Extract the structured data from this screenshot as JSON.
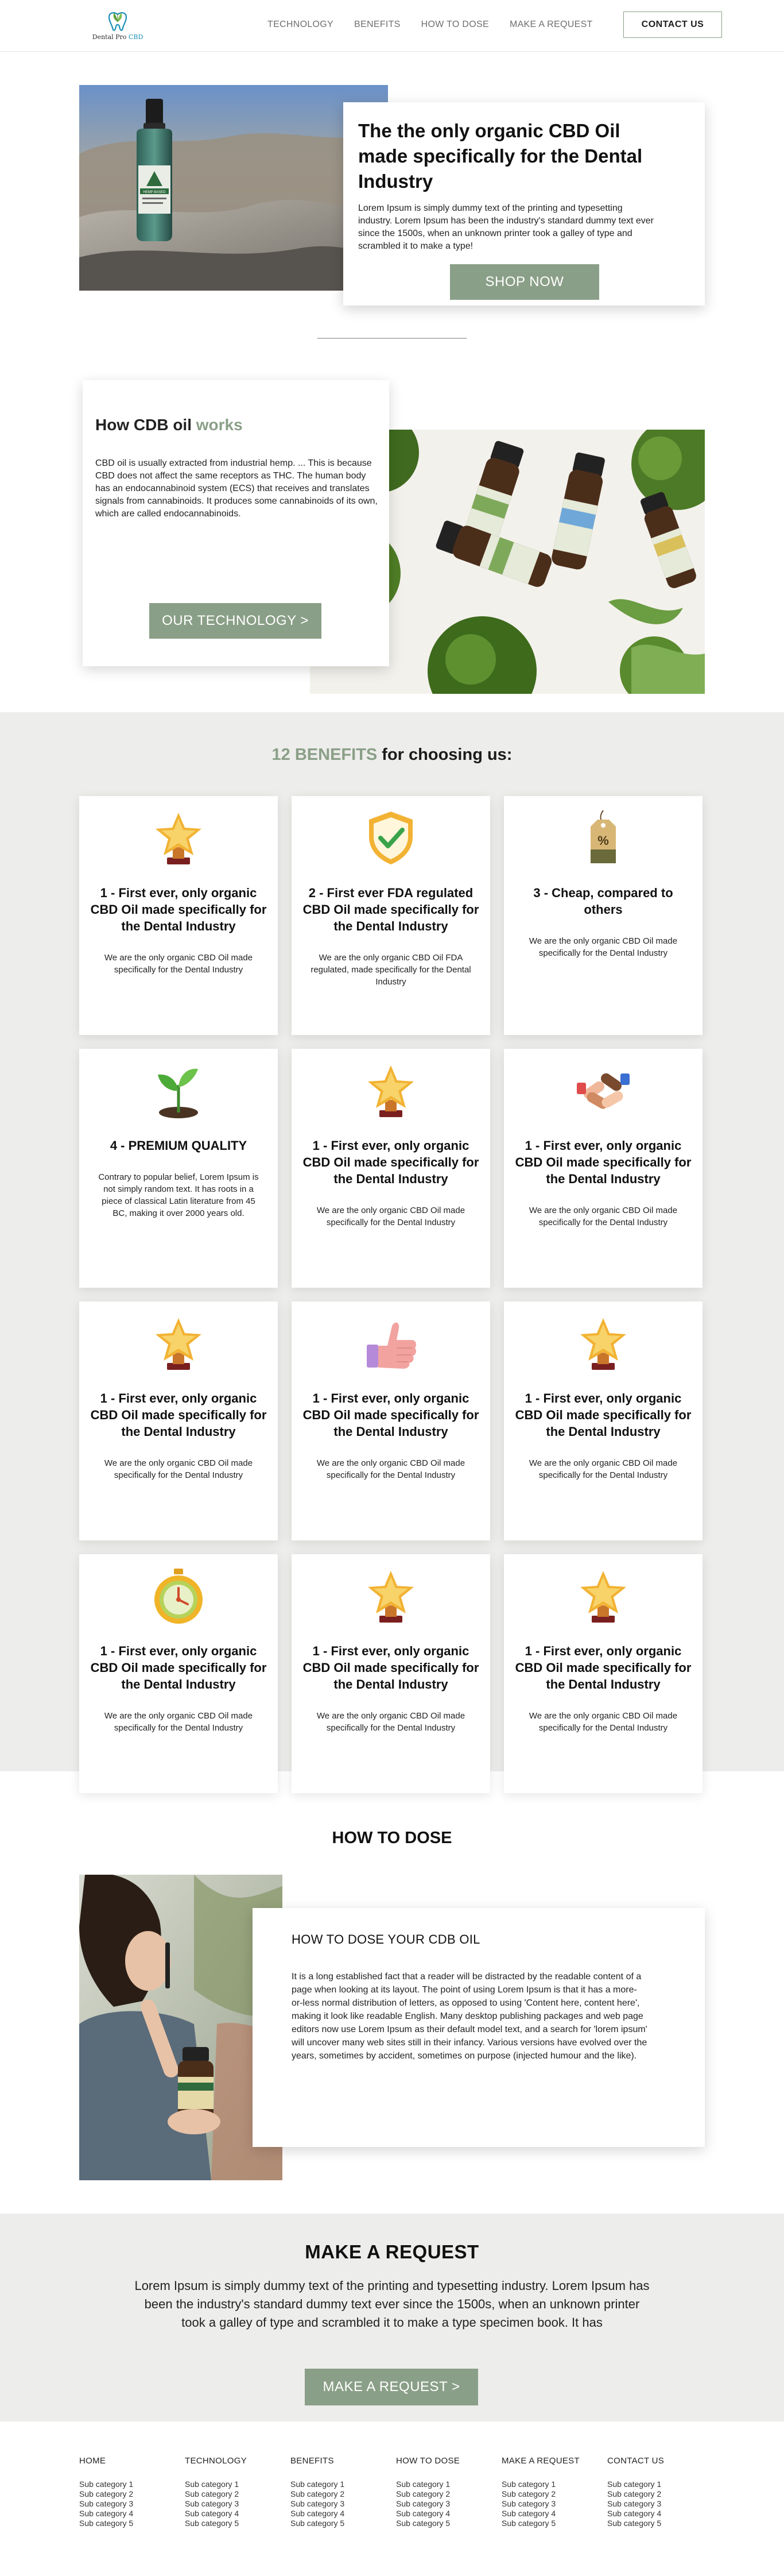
{
  "header": {
    "logo_name": "Dental Pro",
    "logo_cbd": "CBD",
    "nav": [
      "TECHNOLOGY",
      "BENEFITS",
      "HOW TO DOSE",
      "MAKE A REQUEST"
    ],
    "contact_label": "CONTACT US"
  },
  "hero": {
    "title": "The the only organic CBD Oil made specifically for the Dental Industry",
    "text": "Lorem Ipsum is simply dummy text of the printing and typesetting industry. Lorem Ipsum has been the industry's standard dummy text ever since the 1500s, when an unknown printer took a galley of type and scrambled it to make a type!",
    "button": "SHOP NOW",
    "bottle_label": "HEMP BASED"
  },
  "how": {
    "title_pre": "How CDB oil ",
    "title_accent": "works",
    "text": "CBD oil is usually extracted from industrial hemp. ... This is because CBD does not affect the same receptors as THC. The human body has an endocannabinoid system (ECS) that receives and translates signals from cannabinoids. It produces some cannabinoids of its own, which are called endocannabinoids.",
    "button": "OUR TECHNOLOGY >"
  },
  "benefits": {
    "title_accent": "12 BENEFITS",
    "title_rest": " for choosing us:",
    "cards": [
      {
        "icon": "trophy-star-icon",
        "title": "1 - First ever, only organic CBD Oil made specifically for the Dental Industry",
        "text": "We are the only organic CBD Oil made specifically for the Dental Industry"
      },
      {
        "icon": "shield-check-icon",
        "title": "2 - First ever FDA regulated CBD Oil made specifically for the Dental Industry",
        "text": "We are the only organic CBD Oil FDA regulated, made specifically for the Dental Industry"
      },
      {
        "icon": "price-tag-icon",
        "title": "3 - Cheap, compared to others",
        "text": "We are the only organic CBD Oil made specifically for the Dental Industry"
      },
      {
        "icon": "sprout-icon",
        "title": "4 - PREMIUM QUALITY",
        "text": "Contrary to popular belief, Lorem Ipsum is not simply random text. It has roots in a piece of classical Latin literature from 45 BC, making it over 2000 years old."
      },
      {
        "icon": "trophy-star-icon",
        "title": "1 - First ever, only organic CBD Oil made specifically for the Dental Industry",
        "text": "We are the only organic CBD Oil made specifically for the Dental Industry"
      },
      {
        "icon": "hands-together-icon",
        "title": "1 - First ever, only organic CBD Oil made specifically for the Dental Industry",
        "text": "We are the only organic CBD Oil made specifically for the Dental Industry"
      },
      {
        "icon": "trophy-star-icon",
        "title": "1 - First ever, only organic CBD Oil made specifically for the Dental Industry",
        "text": "We are the only organic CBD Oil made specifically for the Dental Industry"
      },
      {
        "icon": "thumbs-up-icon",
        "title": "1 - First ever, only organic CBD Oil made specifically for the Dental Industry",
        "text": "We are the only organic CBD Oil made specifically for the Dental Industry"
      },
      {
        "icon": "trophy-star-icon",
        "title": "1 - First ever, only organic CBD Oil made specifically for the Dental Industry",
        "text": "We are the only organic CBD Oil made specifically for the Dental Industry"
      },
      {
        "icon": "stopwatch-icon",
        "title": "1 - First ever, only organic CBD Oil made specifically for the Dental Industry",
        "text": "We are the only organic CBD Oil made specifically for the Dental Industry"
      },
      {
        "icon": "trophy-star-icon",
        "title": "1 - First ever, only organic CBD Oil made specifically for the Dental Industry",
        "text": "We are the only organic CBD Oil made specifically for the Dental Industry"
      },
      {
        "icon": "trophy-star-icon",
        "title": "1 - First ever, only organic CBD Oil made specifically for the Dental Industry",
        "text": "We are the only organic CBD Oil made specifically for the Dental Industry"
      }
    ]
  },
  "dose": {
    "section_title": "HOW TO DOSE",
    "card_title": "HOW TO DOSE YOUR CDB OIL",
    "text": "It is a long established fact that a reader will be distracted by the readable content of a page when looking at its layout. The point of using Lorem Ipsum is that it has a more-or-less normal distribution of letters, as opposed to using 'Content here, content here', making it look like readable English. Many desktop publishing packages and web page editors now use Lorem Ipsum as their default model text, and a search for 'lorem ipsum' will uncover many web sites still in their infancy. Various versions have evolved over the years, sometimes by accident, sometimes on purpose (injected humour and the like)."
  },
  "request": {
    "title": "MAKE A REQUEST",
    "text": "Lorem Ipsum is simply dummy text of the printing and typesetting industry. Lorem Ipsum has been the industry's standard dummy text ever since the 1500s, when an unknown printer took a galley of type and scrambled it to make a type specimen book. It has",
    "button": "MAKE A REQUEST >"
  },
  "footer": {
    "columns": [
      {
        "title": "HOME",
        "items": [
          "Sub category 1",
          "Sub category 2",
          "Sub category 3",
          "Sub category 4",
          "Sub category 5"
        ]
      },
      {
        "title": "TECHNOLOGY",
        "items": [
          "Sub category 1",
          "Sub category 2",
          "Sub category 3",
          "Sub category 4",
          "Sub category 5"
        ]
      },
      {
        "title": "BENEFITS",
        "items": [
          "Sub category 1",
          "Sub category 2",
          "Sub category 3",
          "Sub category 4",
          "Sub category 5"
        ]
      },
      {
        "title": "HOW TO DOSE",
        "items": [
          "Sub category 1",
          "Sub category 2",
          "Sub category 3",
          "Sub category 4",
          "Sub category 5"
        ]
      },
      {
        "title": "MAKE A REQUEST",
        "items": [
          "Sub category 1",
          "Sub category 2",
          "Sub category 3",
          "Sub category 4",
          "Sub category 5"
        ]
      },
      {
        "title": "CONTACT US",
        "items": [
          "Sub category 1",
          "Sub category 2",
          "Sub category 3",
          "Sub category 4",
          "Sub category 5"
        ]
      }
    ]
  },
  "colors": {
    "accent": "#8a9f87",
    "section_bg": "#ededeb",
    "text": "#1c1c1c"
  }
}
